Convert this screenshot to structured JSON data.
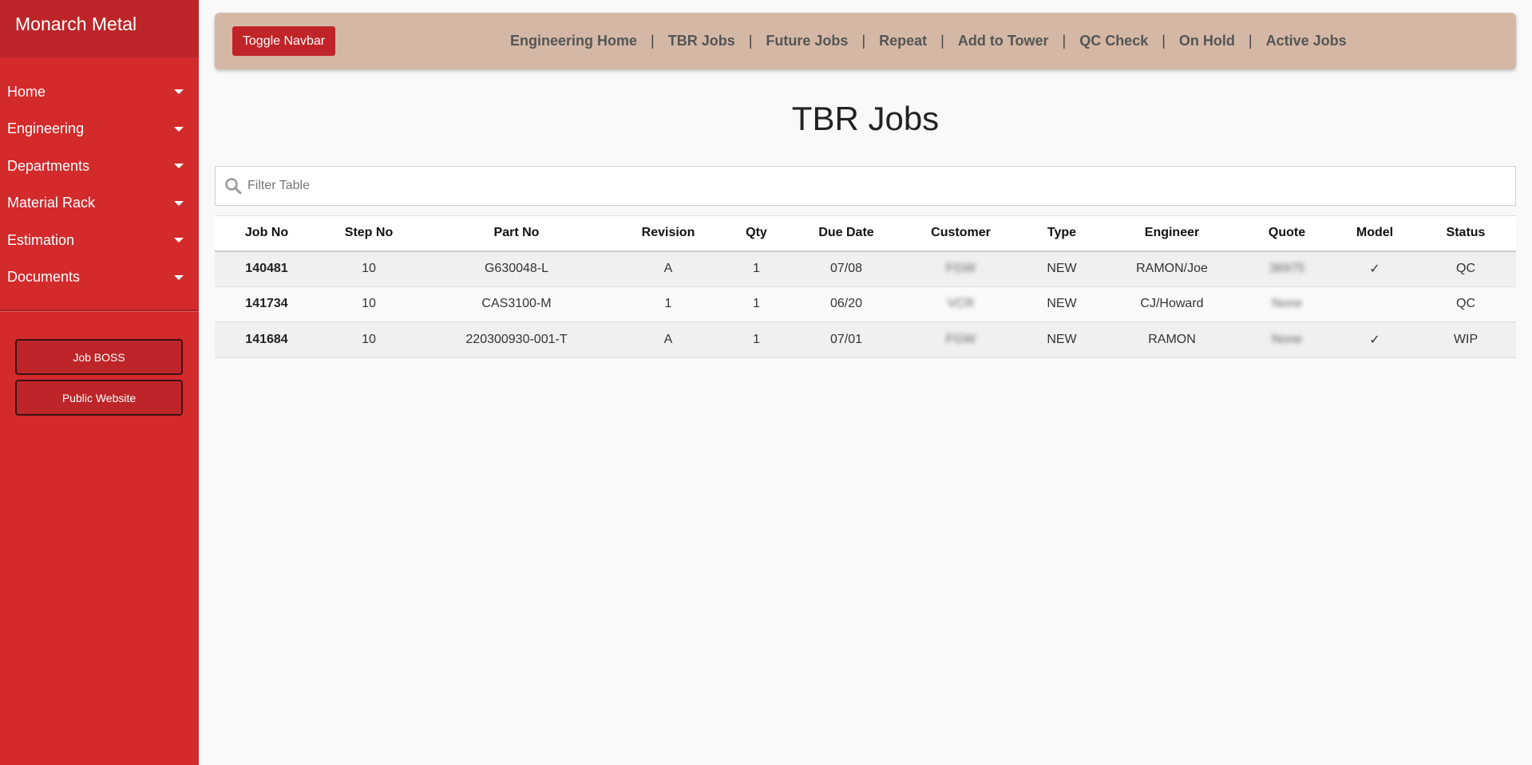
{
  "sidebar": {
    "brand": "Monarch Metal",
    "menu": [
      {
        "label": "Home"
      },
      {
        "label": "Engineering"
      },
      {
        "label": "Departments"
      },
      {
        "label": "Material Rack"
      },
      {
        "label": "Estimation"
      },
      {
        "label": "Documents"
      }
    ],
    "buttons": [
      {
        "label": "Job BOSS"
      },
      {
        "label": "Public Website"
      }
    ]
  },
  "topbar": {
    "toggle_label": "Toggle Navbar",
    "separator": "|",
    "links": [
      {
        "label": "Engineering Home"
      },
      {
        "label": "TBR Jobs"
      },
      {
        "label": "Future Jobs"
      },
      {
        "label": "Repeat"
      },
      {
        "label": "Add to Tower"
      },
      {
        "label": "QC Check"
      },
      {
        "label": "On Hold"
      },
      {
        "label": "Active Jobs"
      }
    ]
  },
  "page": {
    "title": "TBR Jobs",
    "filter_placeholder": "Filter Table"
  },
  "table": {
    "columns": [
      "Job No",
      "Step No",
      "Part No",
      "Revision",
      "Qty",
      "Due Date",
      "Customer",
      "Type",
      "Engineer",
      "Quote",
      "Model",
      "Status"
    ],
    "rows": [
      {
        "job_no": "140481",
        "step_no": "10",
        "part_no": "G630048-L",
        "revision": "A",
        "qty": "1",
        "due_date": "07/08",
        "customer": "FGW",
        "type": "NEW",
        "engineer": "RAMON/Joe",
        "quote": "36975",
        "model": "✓",
        "status": "QC"
      },
      {
        "job_no": "141734",
        "step_no": "10",
        "part_no": "CAS3100-M",
        "revision": "1",
        "qty": "1",
        "due_date": "06/20",
        "customer": "VCR",
        "type": "NEW",
        "engineer": "CJ/Howard",
        "quote": "None",
        "model": "",
        "status": "QC"
      },
      {
        "job_no": "141684",
        "step_no": "10",
        "part_no": "220300930-001-T",
        "revision": "A",
        "qty": "1",
        "due_date": "07/01",
        "customer": "FGW",
        "type": "NEW",
        "engineer": "RAMON",
        "quote": "None",
        "model": "✓",
        "status": "WIP"
      }
    ]
  },
  "colors": {
    "sidebar": "#d32a2c",
    "brand_bar": "#bd2529",
    "topbar": "#d4b8a5",
    "toggle_button": "#c12428"
  },
  "icons": {
    "filter": "search-icon",
    "menu_caret": "caret-down-icon",
    "model_check": "checkmark"
  }
}
